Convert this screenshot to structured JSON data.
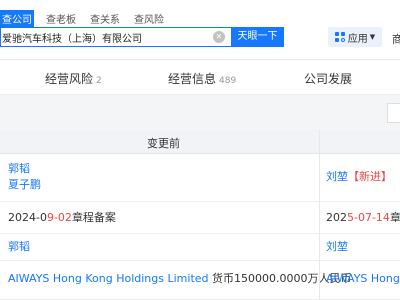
{
  "header": {
    "search_tabs": [
      "查公司",
      "查老板",
      "查关系",
      "查风险"
    ],
    "search_value": "爱驰汽车科技（上海）有限公司",
    "clear_icon": "clear-circle-icon",
    "search_button": "天眼一下",
    "apps_button": "应用",
    "more_text": "商"
  },
  "tabs": [
    {
      "label": "经营风险",
      "count": "2"
    },
    {
      "label": "经营信息",
      "count": "489"
    },
    {
      "label": "公司发展",
      "count": ""
    }
  ],
  "table": {
    "header_before": "变更前",
    "rows": [
      {
        "before_lines": [
          "郭韬",
          "夏子鹏"
        ],
        "after_name": "刘堃",
        "after_tag": "【新进】"
      },
      {
        "before_prefix": "2024-0",
        "before_red": "9-02",
        "before_suffix": "章程备案",
        "after_prefix": "202",
        "after_red": "5-07-14",
        "after_suffix": "章程"
      },
      {
        "before": "郭韬",
        "after": "刘堃"
      },
      {
        "before_link": "AIWAYS Hong Kong Holdings Limited",
        "before_text": " 货币150000.0000万人民币",
        "after_link": "AIWAYS Hong Ko"
      }
    ]
  }
}
